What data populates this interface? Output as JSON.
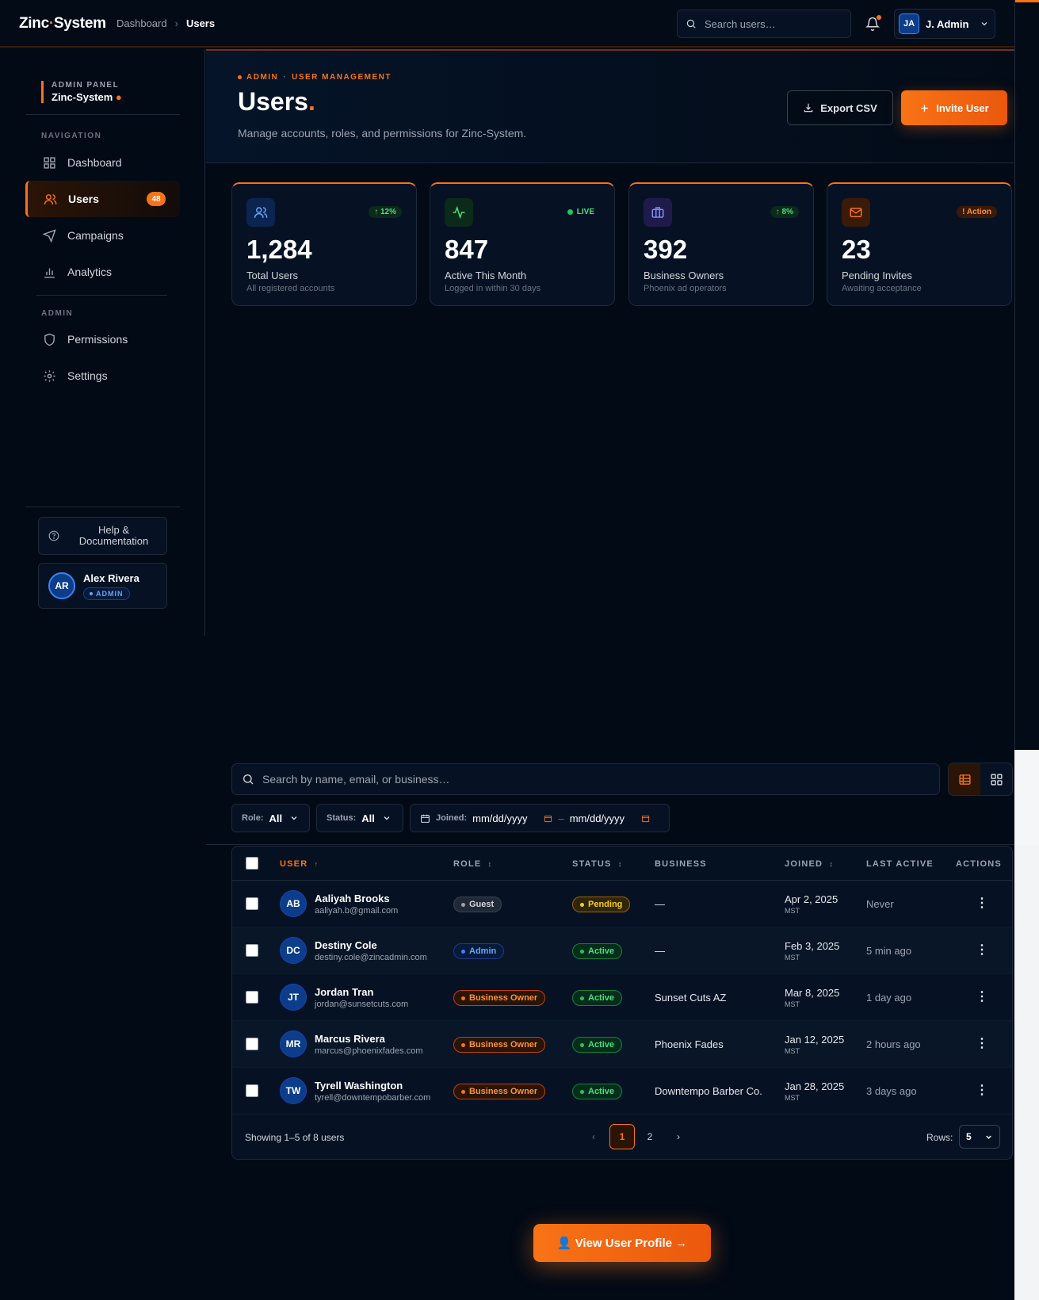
{
  "app": {
    "logo_a": "Zinc",
    "logo_sep": "·",
    "logo_b": "System"
  },
  "breadcrumb": {
    "home": "Dashboard",
    "sep": "›",
    "current": "Users"
  },
  "global_search": {
    "placeholder": "Search users…"
  },
  "user_menu": {
    "initials": "JA",
    "name": "J. Admin"
  },
  "sidebar": {
    "panel_label": "ADMIN PANEL",
    "panel_name": "Zinc-System",
    "nav_heading": "NAVIGATION",
    "nav": [
      {
        "label": "Dashboard",
        "icon": "grid-icon"
      },
      {
        "label": "Users",
        "icon": "users-icon",
        "badge": "48"
      },
      {
        "label": "Campaigns",
        "icon": "send-icon"
      },
      {
        "label": "Analytics",
        "icon": "bar-chart-icon"
      }
    ],
    "admin_heading": "ADMIN",
    "admin_nav": [
      {
        "label": "Permissions",
        "icon": "shield-icon"
      },
      {
        "label": "Settings",
        "icon": "gear-icon"
      }
    ],
    "help_label": "Help & Documentation",
    "profile": {
      "initials": "AR",
      "name": "Alex Rivera",
      "role": "ADMIN"
    }
  },
  "hero": {
    "eyebrow_a": "ADMIN",
    "eyebrow_sep": "·",
    "eyebrow_b": "USER MANAGEMENT",
    "title": "Users",
    "title_dot": ".",
    "subtitle": "Manage accounts, roles, and permissions for Zinc-System.",
    "export_label": "Export CSV",
    "invite_label": "Invite User"
  },
  "stats": [
    {
      "value": "1,284",
      "label": "Total Users",
      "desc": "All registered accounts",
      "tag": "↑ 12%",
      "icon": "users-icon",
      "accent": "#3b82f6"
    },
    {
      "value": "847",
      "label": "Active This Month",
      "desc": "Logged in within 30 days",
      "tag": "LIVE",
      "icon": "activity-icon",
      "accent": "#22c55e"
    },
    {
      "value": "392",
      "label": "Business Owners",
      "desc": "Phoenix ad operators",
      "tag": "↑ 8%",
      "icon": "briefcase-icon",
      "accent": "#818cf8"
    },
    {
      "value": "23",
      "label": "Pending Invites",
      "desc": "Awaiting acceptance",
      "tag": "! Action",
      "icon": "mail-icon",
      "accent": "#f97316"
    }
  ],
  "table_search": {
    "placeholder": "Search by name, email, or business…"
  },
  "filters": {
    "role_key": "Role:",
    "role_val": "All",
    "status_key": "Status:",
    "status_val": "All",
    "joined_key": "Joined:",
    "date_from": "mm/dd/yyyy",
    "date_sep": "–",
    "date_to": "mm/dd/yyyy"
  },
  "columns": {
    "user": "USER",
    "user_sort": "↑",
    "role": "ROLE",
    "role_sort": "↕",
    "status": "STATUS",
    "status_sort": "↕",
    "business": "BUSINESS",
    "joined": "JOINED",
    "joined_sort": "↕",
    "last_active": "LAST ACTIVE",
    "actions": "ACTIONS"
  },
  "rows": [
    {
      "initials": "AB",
      "name": "Aaliyah Brooks",
      "email": "aaliyah.b@gmail.com",
      "role": "Guest",
      "status": "Pending",
      "business": "—",
      "joined": "Apr 2, 2025",
      "tz": "MST",
      "last_active": "Never"
    },
    {
      "initials": "DC",
      "name": "Destiny Cole",
      "email": "destiny.cole@zincadmin.com",
      "role": "Admin",
      "status": "Active",
      "business": "—",
      "joined": "Feb 3, 2025",
      "tz": "MST",
      "last_active": "5 min ago"
    },
    {
      "initials": "JT",
      "name": "Jordan Tran",
      "email": "jordan@sunsetcuts.com",
      "role": "Business Owner",
      "status": "Active",
      "business": "Sunset Cuts AZ",
      "joined": "Mar 8, 2025",
      "tz": "MST",
      "last_active": "1 day ago"
    },
    {
      "initials": "MR",
      "name": "Marcus Rivera",
      "email": "marcus@phoenixfades.com",
      "role": "Business Owner",
      "status": "Active",
      "business": "Phoenix Fades",
      "joined": "Jan 12, 2025",
      "tz": "MST",
      "last_active": "2 hours ago"
    },
    {
      "initials": "TW",
      "name": "Tyrell Washington",
      "email": "tyrell@downtempobarber.com",
      "role": "Business Owner",
      "status": "Active",
      "business": "Downtempo Barber Co.",
      "joined": "Jan 28, 2025",
      "tz": "MST",
      "last_active": "3 days ago"
    }
  ],
  "footer": {
    "showing": "Showing 1–5 of 8 users",
    "prev": "‹",
    "page1": "1",
    "page2": "2",
    "next": "›",
    "rows_label": "Rows:",
    "rows_value": "5"
  },
  "view_profile_label": "👤 View User Profile →",
  "colors": {
    "accent": "#f97316",
    "bg": "#020a16",
    "panel": "#061224",
    "active": "#22c55e",
    "pending": "#facc15",
    "admin": "#3b82f6"
  }
}
